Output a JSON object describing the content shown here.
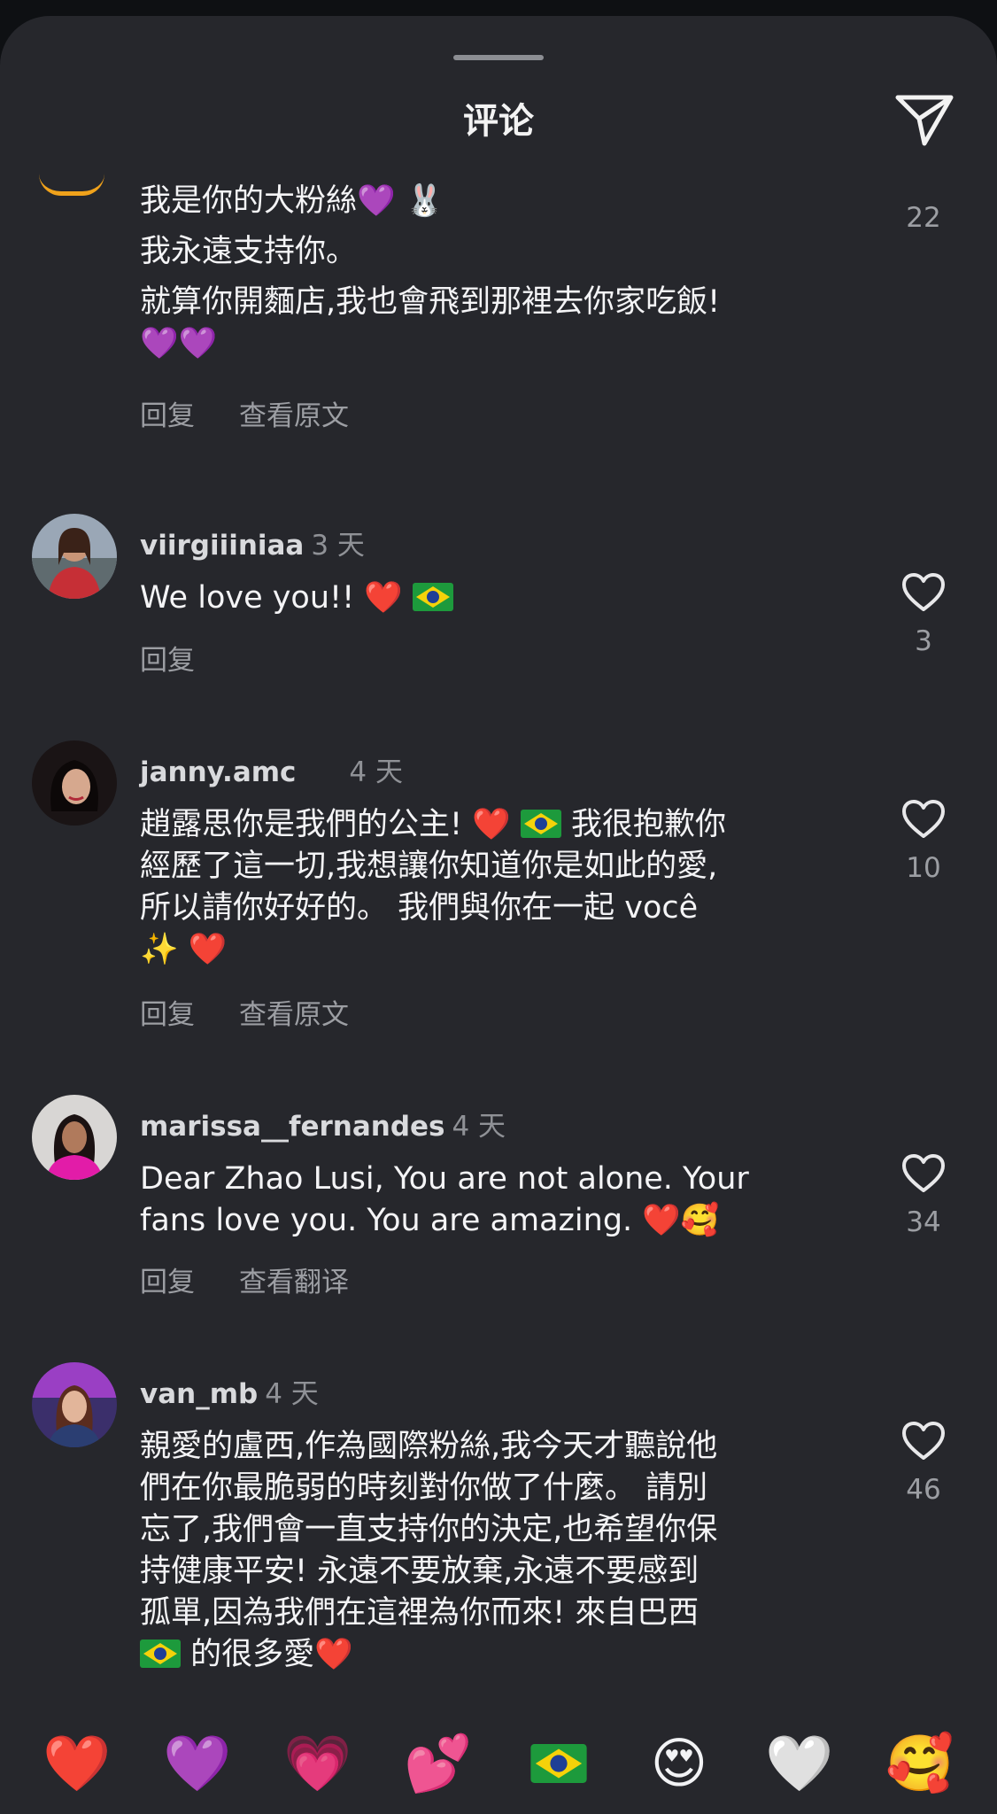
{
  "header": {
    "title": "评论"
  },
  "comments": [
    {
      "username": "",
      "time": "",
      "lines": [
        "我是你的大粉絲💜 🐰",
        "我永遠支持你。",
        "就算你開麵店,我也會飛到那裡去你家吃飯!",
        "💜💜"
      ],
      "actions": [
        "回复",
        "查看原文"
      ],
      "likes": "22"
    },
    {
      "username": "viirgiiiniaa",
      "time": "3 天",
      "lines": [
        "We love you!! ❤️"
      ],
      "actions": [
        "回复"
      ],
      "likes": "3"
    },
    {
      "username": "janny.amc",
      "time": "4 天",
      "lines": [
        "趙露思你是我們的公主! ❤️",
        "我很抱歉你",
        "經歷了這一切,我想讓你知道你是如此的愛,",
        "所以請你好好的。 我們與你在一起 você",
        "✨ ❤️"
      ],
      "actions": [
        "回复",
        "查看原文"
      ],
      "likes": "10"
    },
    {
      "username": "marissa__fernandes",
      "time": "4 天",
      "lines": [
        "Dear Zhao Lusi, You are not alone. Your",
        "fans love you. You are amazing. ❤️🥰"
      ],
      "actions": [
        "回复",
        "查看翻译"
      ],
      "likes": "34"
    },
    {
      "username": "van_mb",
      "time": "4 天",
      "lines": [
        "親愛的盧西,作為國際粉絲,我今天才聽說他",
        "們在你最脆弱的時刻對你做了什麼。 請別",
        "忘了,我們會一直支持你的決定,也希望你保",
        "持健康平安! 永遠不要放棄,永遠不要感到",
        "孤單,因為我們在這裡為你而來! 來自巴西",
        "的很多愛❤️"
      ],
      "actions": [],
      "likes": "46"
    }
  ],
  "emoji_bar": [
    "❤️",
    "💜",
    "💗",
    "💕",
    "🇧🇷",
    "😍",
    "🤍",
    "🥰"
  ],
  "colors": {
    "background": "#26272c",
    "text": "#f4f4f6",
    "muted": "#9c9ea3"
  }
}
